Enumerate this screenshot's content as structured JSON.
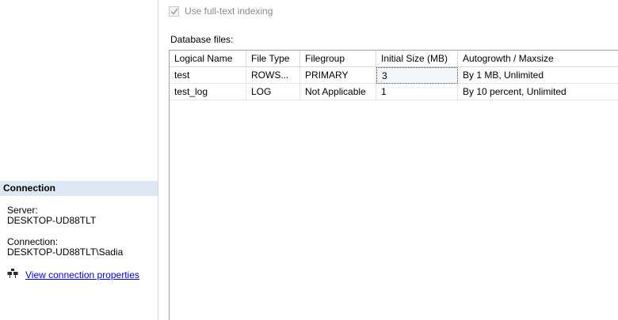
{
  "connection": {
    "header": "Connection",
    "server_label": "Server:",
    "server_value": "DESKTOP-UD88TLT",
    "connection_label": "Connection:",
    "connection_value": "DESKTOP-UD88TLT\\Sadia",
    "link_icon": "plug-icon",
    "link_label": "View connection properties"
  },
  "options": {
    "fulltext_label": "Use full-text indexing",
    "fulltext_checked": true
  },
  "database_files": {
    "label": "Database files:",
    "columns": [
      "Logical Name",
      "File Type",
      "Filegroup",
      "Initial Size (MB)",
      "Autogrowth / Maxsize"
    ],
    "rows": [
      [
        "test",
        "ROWS...",
        "PRIMARY",
        "3",
        "By 1 MB, Unlimited"
      ],
      [
        "test_log",
        "LOG",
        "Not Applicable",
        "1",
        "By 10 percent, Unlimited"
      ]
    ]
  }
}
